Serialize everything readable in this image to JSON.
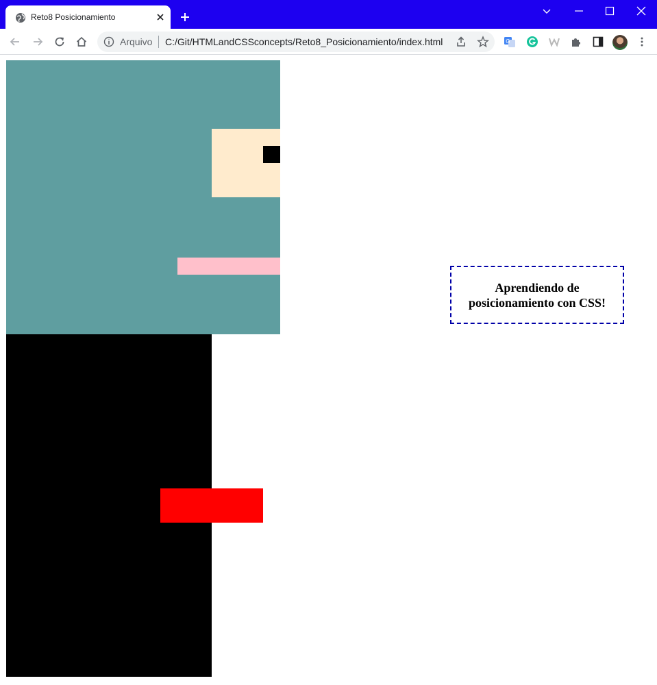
{
  "window": {
    "tab_title": "Reto8 Posicionamiento",
    "titlebar_color": "#1d00f0"
  },
  "toolbar": {
    "omnibox_label": "Arquivo",
    "url": "C:/Git/HTMLandCSSconcepts/Reto8_Posicionamiento/index.html"
  },
  "page": {
    "note_line1": "Aprendiendo de",
    "note_line2": "posicionamiento con CSS!",
    "colors": {
      "teal": "#5f9ea0",
      "cream": "#ffebcd",
      "pink": "#ffc0cb",
      "black": "#000000",
      "red": "#ff0000",
      "note_border": "#0000a8"
    }
  }
}
